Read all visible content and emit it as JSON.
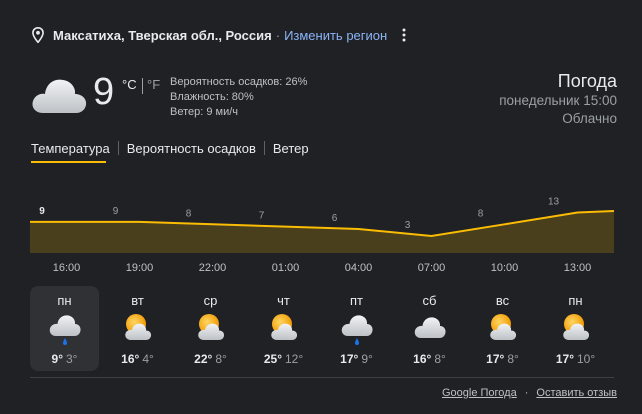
{
  "location": {
    "name": "Максатиха, Тверская обл., Россия",
    "separator": "·",
    "change_link": "Изменить регион"
  },
  "current": {
    "icon": "cloudy-icon",
    "temperature": "9",
    "unit_c": "°C",
    "unit_f": "°F",
    "precip": "Вероятность осадков: 26%",
    "humidity": "Влажность: 80%",
    "wind": "Ветер: 9 ми/ч"
  },
  "header": {
    "title": "Погода",
    "datetime": "понедельник 15:00",
    "condition": "Облачно"
  },
  "tabs": [
    "Температура",
    "Вероятность осадков",
    "Ветер"
  ],
  "chart_data": {
    "type": "area",
    "labels": [
      "9",
      "9",
      "8",
      "7",
      "6",
      "3",
      "8",
      "13"
    ],
    "values": [
      9,
      9,
      8,
      7,
      6,
      3,
      8,
      13
    ],
    "x": [
      "16:00",
      "19:00",
      "22:00",
      "01:00",
      "04:00",
      "07:00",
      "10:00",
      "13:00"
    ],
    "colors": {
      "line": "#fbbc04",
      "fill": "#4a3f1c"
    }
  },
  "days": [
    {
      "name": "пн",
      "icon": "cloud-rain-icon",
      "hi": "9°",
      "lo": "3°"
    },
    {
      "name": "вт",
      "icon": "partly-cloudy-icon",
      "hi": "16°",
      "lo": "4°"
    },
    {
      "name": "ср",
      "icon": "partly-cloudy-icon",
      "hi": "22°",
      "lo": "8°"
    },
    {
      "name": "чт",
      "icon": "partly-cloudy-icon",
      "hi": "25°",
      "lo": "12°"
    },
    {
      "name": "пт",
      "icon": "cloud-rain-icon",
      "hi": "17°",
      "lo": "9°"
    },
    {
      "name": "сб",
      "icon": "cloudy-icon",
      "hi": "16°",
      "lo": "8°"
    },
    {
      "name": "вс",
      "icon": "partly-cloudy-icon",
      "hi": "17°",
      "lo": "8°"
    },
    {
      "name": "пн",
      "icon": "partly-cloudy-icon",
      "hi": "17°",
      "lo": "10°"
    }
  ],
  "footer": {
    "source_link": "Google Погода",
    "separator": "·",
    "feedback_link": "Оставить отзыв"
  }
}
